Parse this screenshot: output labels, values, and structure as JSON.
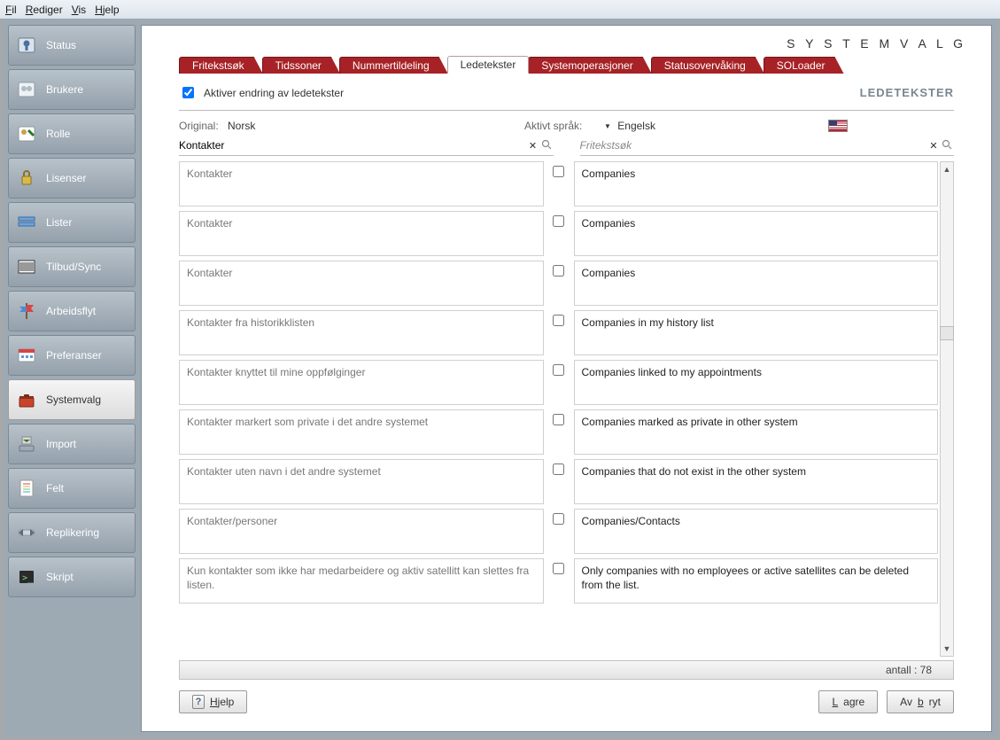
{
  "menu": {
    "file": "Fil",
    "edit": "Rediger",
    "view": "Vis",
    "help": "Hjelp"
  },
  "sidebar": {
    "items": [
      {
        "label": "Status"
      },
      {
        "label": "Brukere"
      },
      {
        "label": "Rolle"
      },
      {
        "label": "Lisenser"
      },
      {
        "label": "Lister"
      },
      {
        "label": "Tilbud/Sync"
      },
      {
        "label": "Arbeidsflyt"
      },
      {
        "label": "Preferanser"
      },
      {
        "label": "Systemvalg"
      },
      {
        "label": "Import"
      },
      {
        "label": "Felt"
      },
      {
        "label": "Replikering"
      },
      {
        "label": "Skript"
      }
    ],
    "active_index": 8
  },
  "header": {
    "title": "S Y S T E M V A L G"
  },
  "tabs": {
    "items": [
      {
        "label": "Fritekstsøk"
      },
      {
        "label": "Tidssoner"
      },
      {
        "label": "Nummertildeling"
      },
      {
        "label": "Ledetekster"
      },
      {
        "label": "Systemoperasjoner"
      },
      {
        "label": "Statusovervåking"
      },
      {
        "label": "SOLoader"
      }
    ],
    "active_index": 3
  },
  "panel": {
    "enable_label": "Aktiver endring av ledetekster",
    "title": "LEDETEKSTER",
    "original_label": "Original:",
    "original_value": "Norsk",
    "active_lang_label": "Aktivt språk:",
    "active_lang_value": "Engelsk",
    "search_left_value": "Kontakter",
    "search_right_placeholder": "Fritekstsøk"
  },
  "rows": [
    {
      "orig": "Kontakter",
      "trans": "Companies"
    },
    {
      "orig": "Kontakter",
      "trans": "Companies"
    },
    {
      "orig": "Kontakter",
      "trans": "Companies"
    },
    {
      "orig": "Kontakter fra historikklisten",
      "trans": "Companies in my history list"
    },
    {
      "orig": "Kontakter knyttet til mine oppfølginger",
      "trans": "Companies linked to my appointments"
    },
    {
      "orig": "Kontakter markert som private i det andre systemet",
      "trans": "Companies marked as private in other system"
    },
    {
      "orig": "Kontakter uten navn i det andre systemet",
      "trans": "Companies that do not exist in the other system"
    },
    {
      "orig": "Kontakter/personer",
      "trans": "Companies/Contacts"
    },
    {
      "orig": "Kun kontakter som ikke har medarbeidere og aktiv satellitt kan slettes fra listen.",
      "trans": "Only companies with no employees or active satellites can be deleted from the list."
    }
  ],
  "status": {
    "count_label": "antall : 78"
  },
  "buttons": {
    "help": "Hjelp",
    "save": "Lagre",
    "cancel": "Avbryt"
  }
}
